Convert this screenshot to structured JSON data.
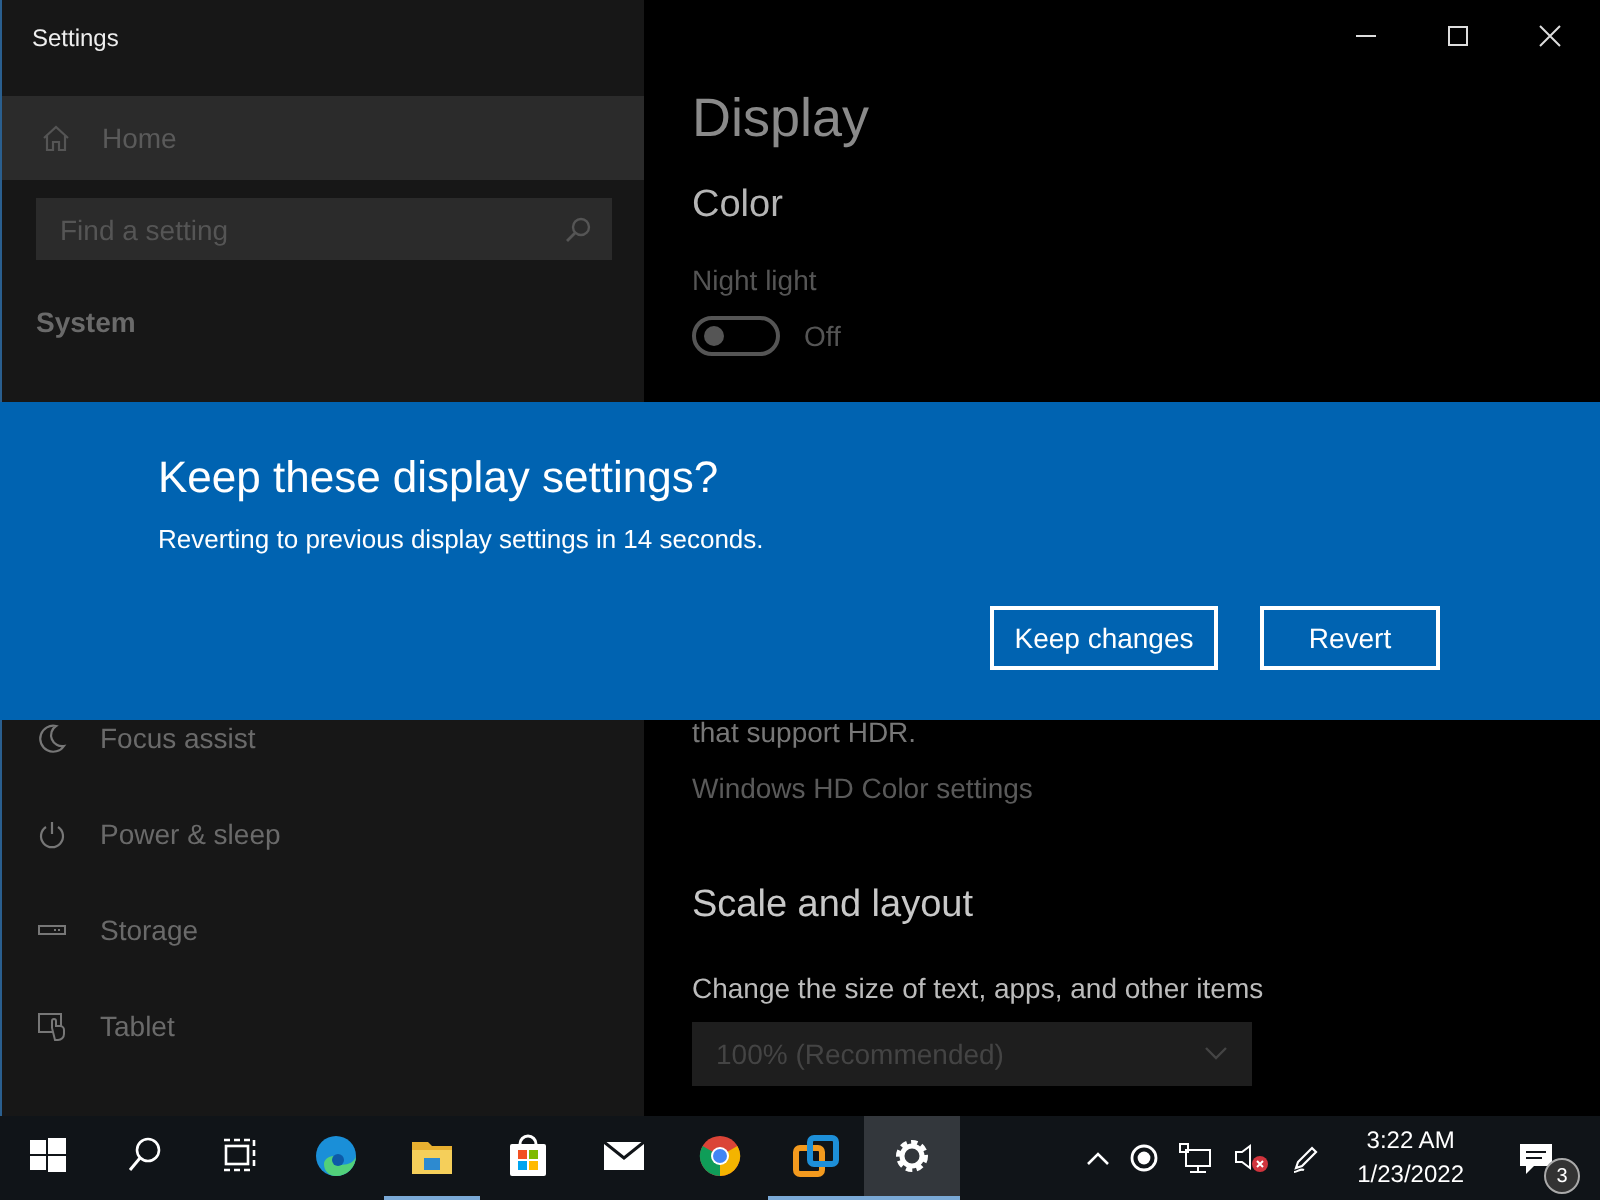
{
  "window": {
    "title": "Settings"
  },
  "sidebar": {
    "home": {
      "label": "Home"
    },
    "search": {
      "placeholder": "Find a setting"
    },
    "section": "System",
    "items": [
      {
        "label": "Focus assist",
        "kind": "moon"
      },
      {
        "label": "Power & sleep",
        "kind": "power"
      },
      {
        "label": "Storage",
        "kind": "storage"
      },
      {
        "label": "Tablet",
        "kind": "tablet"
      }
    ]
  },
  "content": {
    "title": "Display",
    "color_heading": "Color",
    "night_light": {
      "label": "Night light",
      "on": false,
      "state_text": "Off"
    },
    "hdr_text": "that support HDR.",
    "hdr_link": "Windows HD Color settings",
    "scale_heading": "Scale and layout",
    "scale_label": "Change the size of text, apps, and other items",
    "scale_value": "100% (Recommended)"
  },
  "dialog": {
    "title": "Keep these display settings?",
    "message": "Reverting to previous display settings in 14 seconds.",
    "buttons": [
      "Keep changes",
      "Revert"
    ]
  },
  "taskbar": {
    "apps": [
      {
        "kind": "start",
        "running": false,
        "active": false
      },
      {
        "kind": "search",
        "running": false,
        "active": false
      },
      {
        "kind": "taskview",
        "running": false,
        "active": false
      },
      {
        "kind": "edge",
        "running": false,
        "active": false
      },
      {
        "kind": "folder",
        "running": true,
        "active": false
      },
      {
        "kind": "store",
        "running": false,
        "active": false
      },
      {
        "kind": "mail",
        "running": false,
        "active": false
      },
      {
        "kind": "chrome",
        "running": false,
        "active": false
      },
      {
        "kind": "vm",
        "running": true,
        "active": false
      },
      {
        "kind": "gear",
        "running": true,
        "active": true
      }
    ],
    "time": "3:22 AM",
    "date": "1/23/2022",
    "notifications": "3"
  }
}
